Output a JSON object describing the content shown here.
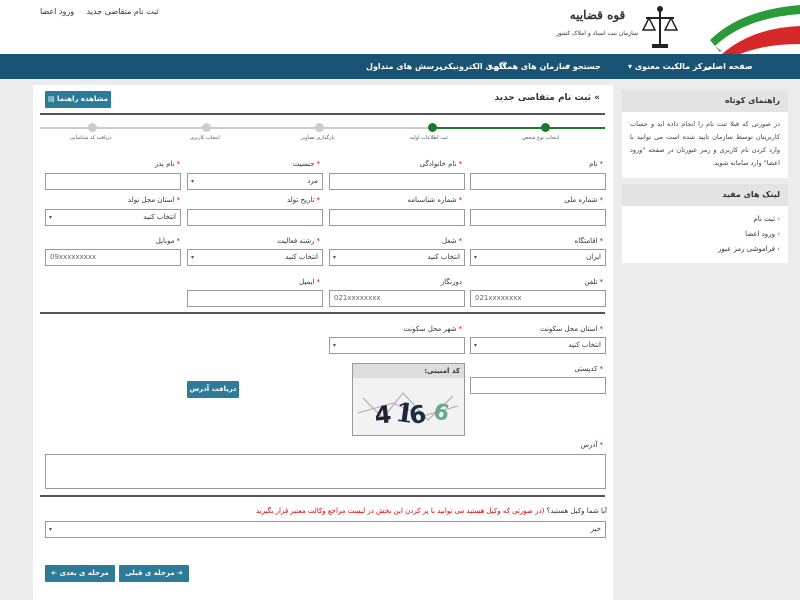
{
  "header": {
    "org_title_line1": "قوه قضاییه",
    "org_title_line2": "سازمان ثبت اسناد و املاک کشور",
    "top_links": {
      "register": "ثبت نام متقاضی جدید",
      "login": "ورود اعضا"
    }
  },
  "nav": [
    "صفحه اصلی",
    "مرکز مالکیت معنوی",
    "جستجو",
    "سازمان های همکار",
    "آگهی الکترونیکی",
    "پرسش های متداول"
  ],
  "sidebar": {
    "guide_title": "راهنمای کوتاه",
    "guide_text": "در صورتی که قبلا ثبت نام را انجام داده اید و حساب کاربریتان توسط سازمان تایید شده است می توانید با وارد کردن نام کاربری و رمز عبورتان در صفحه \"ورود اعضا\" وارد سامانه شوید.",
    "links_title": "لینک های مفید",
    "links": [
      "ثبت نام",
      "ورود اعضا",
      "فراموشی رمز عبور"
    ]
  },
  "page": {
    "title": "ثبت نام متقاضی جدید",
    "help_button": "مشاهده راهنما"
  },
  "steps": [
    "انتخاب نوع شخص",
    "ثبت اطلاعات اولیه",
    "بارگذاری تصاویر",
    "انتخاب کاربری",
    "دریافت کد شناسایی"
  ],
  "form": {
    "name_label": "نام",
    "family_label": "نام خانوادگی",
    "gender_label": "جنسیت",
    "gender_value": "مرد",
    "father_label": "نام پدر",
    "national_id_label": "شماره ملی",
    "id_number_label": "شماره شناسنامه",
    "birth_date_label": "تاریخ تولد",
    "birth_province_label": "استان محل تولد",
    "birth_province_value": "انتخاب کنید",
    "nationality_label": "اقامتگاه",
    "nationality_value": "ایران",
    "job_label": "شغل",
    "job_value": "انتخاب کنید",
    "field_label": "رشته فعالیت",
    "field_value": "انتخاب کنید",
    "mobile_label": "موبایل",
    "mobile_placeholder": "09xxxxxxxxx",
    "phone_label": "تلفن",
    "phone_placeholder": "021xxxxxxxx",
    "fax_label": "دورنگار",
    "fax_placeholder": "021xxxxxxxx",
    "email_label": "ایمیل",
    "res_province_label": "استان محل سکونت",
    "res_province_value": "انتخاب کنید",
    "res_city_label": "شهر محل سکونت",
    "postal_label": "کدپستی",
    "captcha_title": "کد امنیتی:",
    "get_address_button": "دریافت آدرس",
    "address_label": "آدرس",
    "lawyer_question": "آیا شما وکیل هستید؟",
    "lawyer_note": "(در صورتی که وکیل هستید می توانید با پر کردن این بخش در لیست مراجع وکالت معتبر قرار بگیرید )",
    "lawyer_value": "خیر",
    "next_button": "مرحله ی بعدی",
    "prev_button": "مرحله ی قبلی"
  },
  "colors": {
    "nav_bg": "#1a5474",
    "accent": "#2e7b99",
    "step_active": "#1a7a2a",
    "required": "#dd0000"
  }
}
